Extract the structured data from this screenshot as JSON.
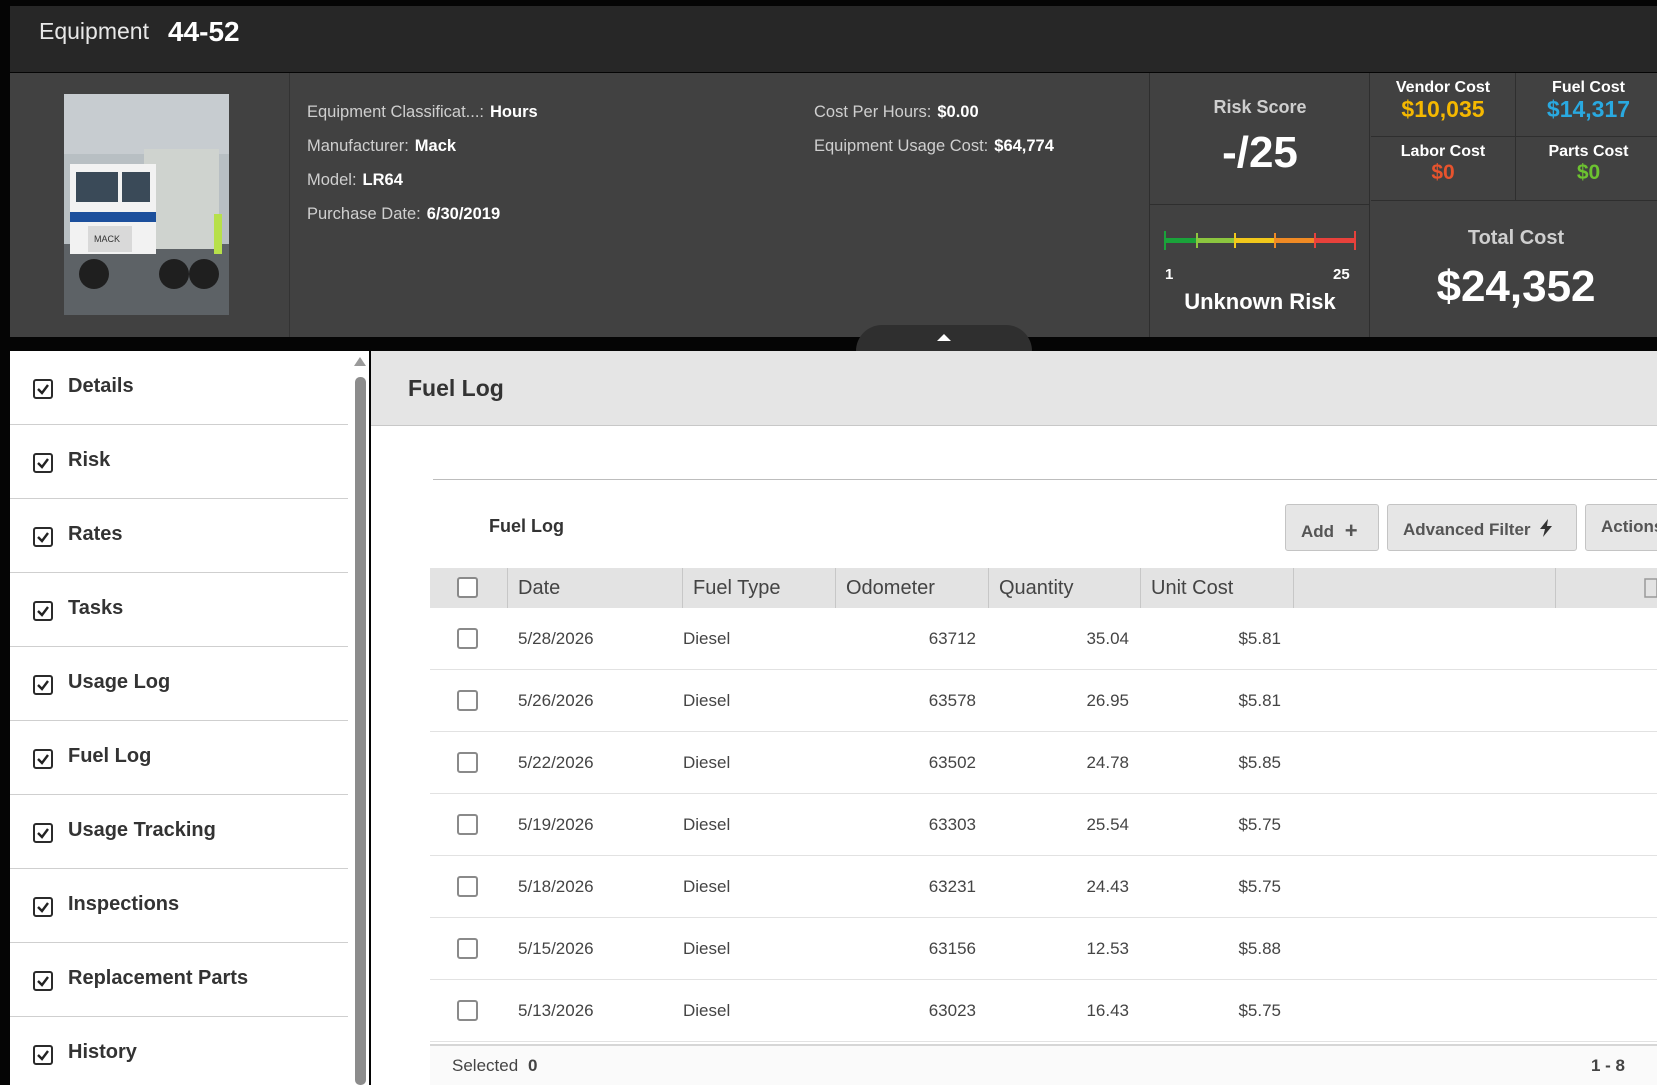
{
  "title": {
    "label": "Equipment",
    "id": "44-52"
  },
  "info": {
    "fields_left": [
      {
        "label": "Equipment Classificat...:",
        "value": "Hours"
      },
      {
        "label": "Manufacturer:",
        "value": "Mack"
      },
      {
        "label": "Model:",
        "value": "LR64"
      },
      {
        "label": "Purchase Date:",
        "value": "6/30/2019"
      }
    ],
    "fields_right": [
      {
        "label": "Cost Per Hours:",
        "value": "$0.00"
      },
      {
        "label": "Equipment Usage Cost:",
        "value": "$64,774"
      }
    ]
  },
  "risk": {
    "label": "Risk Score",
    "value": "-/25",
    "min": "1",
    "max": "25",
    "status": "Unknown Risk"
  },
  "costs": {
    "vendor": {
      "label": "Vendor Cost",
      "value": "$10,035",
      "color": "#f5b800"
    },
    "fuel": {
      "label": "Fuel Cost",
      "value": "$14,317",
      "color": "#29a9e0"
    },
    "labor": {
      "label": "Labor Cost",
      "value": "$0",
      "color": "#e8532d"
    },
    "parts": {
      "label": "Parts Cost",
      "value": "$0",
      "color": "#6cc230"
    },
    "total_label": "Total Cost",
    "total_value": "$24,352"
  },
  "sidebar": {
    "items": [
      {
        "label": "Details"
      },
      {
        "label": "Risk"
      },
      {
        "label": "Rates"
      },
      {
        "label": "Tasks"
      },
      {
        "label": "Usage Log"
      },
      {
        "label": "Fuel Log"
      },
      {
        "label": "Usage Tracking"
      },
      {
        "label": "Inspections"
      },
      {
        "label": "Replacement Parts"
      },
      {
        "label": "History"
      }
    ]
  },
  "main": {
    "title": "Fuel Log",
    "grid_title": "Fuel Log",
    "buttons": {
      "add": "Add",
      "advanced_filter": "Advanced Filter",
      "actions": "Actions"
    },
    "columns": [
      "Date",
      "Fuel Type",
      "Odometer",
      "Quantity",
      "Unit Cost"
    ],
    "rows": [
      {
        "date": "5/28/2026",
        "fuel_type": "Diesel",
        "odometer": "63712",
        "quantity": "35.04",
        "unit_cost": "$5.81"
      },
      {
        "date": "5/26/2026",
        "fuel_type": "Diesel",
        "odometer": "63578",
        "quantity": "26.95",
        "unit_cost": "$5.81"
      },
      {
        "date": "5/22/2026",
        "fuel_type": "Diesel",
        "odometer": "63502",
        "quantity": "24.78",
        "unit_cost": "$5.85"
      },
      {
        "date": "5/19/2026",
        "fuel_type": "Diesel",
        "odometer": "63303",
        "quantity": "25.54",
        "unit_cost": "$5.75"
      },
      {
        "date": "5/18/2026",
        "fuel_type": "Diesel",
        "odometer": "63231",
        "quantity": "24.43",
        "unit_cost": "$5.75"
      },
      {
        "date": "5/15/2026",
        "fuel_type": "Diesel",
        "odometer": "63156",
        "quantity": "12.53",
        "unit_cost": "$5.88"
      },
      {
        "date": "5/13/2026",
        "fuel_type": "Diesel",
        "odometer": "63023",
        "quantity": "16.43",
        "unit_cost": "$5.75"
      }
    ],
    "footer": {
      "selected_label": "Selected",
      "selected_count": "0",
      "paging": "1 - 8"
    }
  }
}
